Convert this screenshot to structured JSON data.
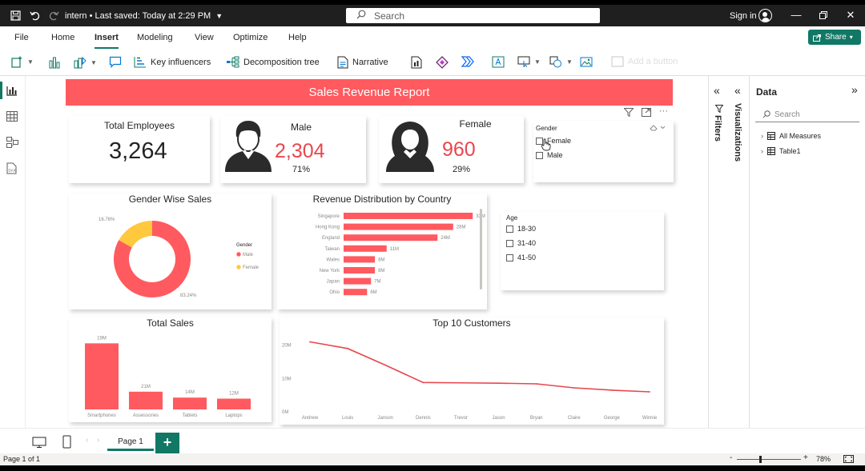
{
  "titlebar": {
    "doc_name": "intern",
    "saved": "Last saved: Today at 2:29 PM",
    "search_placeholder": "Search",
    "sign_in": "Sign in"
  },
  "menu": {
    "tabs": [
      "File",
      "Home",
      "Insert",
      "Modeling",
      "View",
      "Optimize",
      "Help"
    ],
    "active": "Insert",
    "share": "Share"
  },
  "toolbar": {
    "key_influencers": "Key influencers",
    "decomposition_tree": "Decomposition tree",
    "narrative": "Narrative",
    "disabled_label": "Add a button"
  },
  "report": {
    "banner": "Sales Revenue Report",
    "total_employees": {
      "title": "Total Employees",
      "value": "3,264"
    },
    "male": {
      "title": "Male",
      "value": "2,304",
      "pct": "71%"
    },
    "female": {
      "title": "Female",
      "value": "960",
      "pct": "29%"
    },
    "gender_slicer": {
      "title": "Gender",
      "items": [
        "Female",
        "Male"
      ]
    },
    "age_slicer": {
      "title": "Age",
      "items": [
        "18-30",
        "31-40",
        "41-50"
      ]
    },
    "colors": {
      "accent": "#ff5a5f",
      "male": "#ff5a5f",
      "female": "#ffc83d",
      "brand": "#117865"
    }
  },
  "charts": {
    "gender_sales": {
      "title": "Gender Wise Sales",
      "legend_title": "Gender",
      "legend": [
        "Male",
        "Female"
      ],
      "labels": {
        "female": "16.76%",
        "male": "83.24%"
      }
    },
    "revenue_country": {
      "title": "Revenue Distribution by Country"
    },
    "total_sales": {
      "title": "Total Sales"
    },
    "top_customers": {
      "title": "Top 10 Customers"
    }
  },
  "chart_data": [
    {
      "type": "pie",
      "title": "Gender Wise Sales",
      "legend": [
        "Male",
        "Female"
      ],
      "labels": [
        "Male",
        "Female"
      ],
      "values": [
        83.24,
        16.76
      ],
      "colors": [
        "#ff5a5f",
        "#ffc83d"
      ],
      "donut": true,
      "legend_placement": "right"
    },
    {
      "type": "bar",
      "orientation": "horizontal",
      "title": "Revenue Distribution by Country",
      "categories": [
        "Singapore",
        "Hong Kong",
        "England",
        "Taiwan",
        "Wales",
        "New York",
        "Japan",
        "Ohio"
      ],
      "values": [
        33,
        28,
        24,
        11,
        8,
        8,
        7,
        6
      ],
      "data_labels": [
        "33M",
        "28M",
        "24M",
        "11M",
        "8M",
        "8M",
        "7M",
        "6M"
      ],
      "xlim": [
        0,
        35
      ]
    },
    {
      "type": "bar",
      "title": "Total Sales",
      "categories": [
        "Smartphones",
        "Assessories",
        "Tablets",
        "Laptops"
      ],
      "values": [
        19,
        5.1,
        3.4,
        3.1
      ],
      "data_labels": [
        "19M",
        "21M",
        "14M",
        "12M"
      ],
      "ylim": [
        0,
        20
      ]
    },
    {
      "type": "line",
      "title": "Top 10 Customers",
      "categories": [
        "Andrew",
        "Louis",
        "Janson",
        "Dennis",
        "Trevor",
        "Jason",
        "Bryan",
        "Claire",
        "George",
        "Winnie"
      ],
      "values": [
        21,
        19,
        14,
        8.8,
        8.7,
        8.6,
        8.4,
        7.2,
        6.5,
        6
      ],
      "ylim": [
        0,
        24
      ],
      "yticks": [
        "0M",
        "10M",
        "20M"
      ],
      "grid": false
    }
  ],
  "panes": {
    "filters": "Filters",
    "visualizations": "Visualizations",
    "data_title": "Data",
    "data_search": "Search",
    "tree": [
      "All Measures",
      "Table1"
    ]
  },
  "pages": {
    "tab": "Page 1",
    "add": "+"
  },
  "status": {
    "page": "Page 1 of 1",
    "zoom": "78%"
  }
}
